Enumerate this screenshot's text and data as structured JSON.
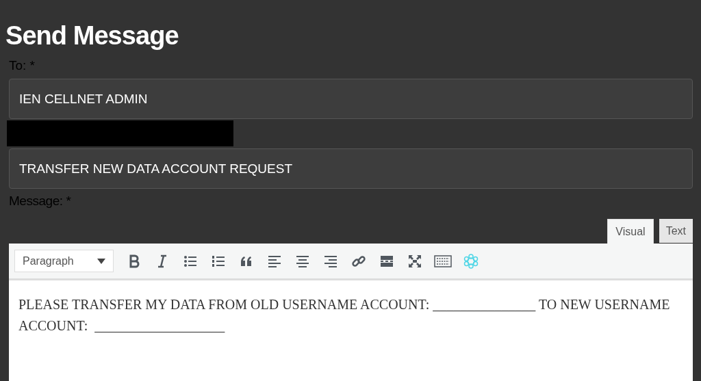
{
  "title": "Send Message",
  "to": {
    "label": "To: *",
    "value": "IEN CELLNET ADMIN"
  },
  "subject": {
    "value": "TRANSFER NEW DATA ACCOUNT REQUEST"
  },
  "message": {
    "label": "Message: *"
  },
  "editor_tabs": [
    {
      "label": "Visual",
      "selected": true
    },
    {
      "label": "Text",
      "selected": false
    }
  ],
  "toolbar": {
    "format": "Paragraph",
    "buttons": [
      {
        "kind": "bold"
      },
      {
        "kind": "italic"
      },
      {
        "kind": "bullets"
      },
      {
        "kind": "numbers"
      },
      {
        "kind": "quote"
      },
      {
        "kind": "left"
      },
      {
        "kind": "center"
      },
      {
        "kind": "right"
      },
      {
        "kind": "link"
      },
      {
        "kind": "more"
      },
      {
        "kind": "fullscreen"
      },
      {
        "kind": "keyboard"
      },
      {
        "kind": "flower"
      }
    ]
  },
  "body": "PLEASE TRANSFER MY DATA FROM OLD USERNAME ACCOUNT: _______________ TO NEW USERNAME ACCOUNT:  ___________________"
}
